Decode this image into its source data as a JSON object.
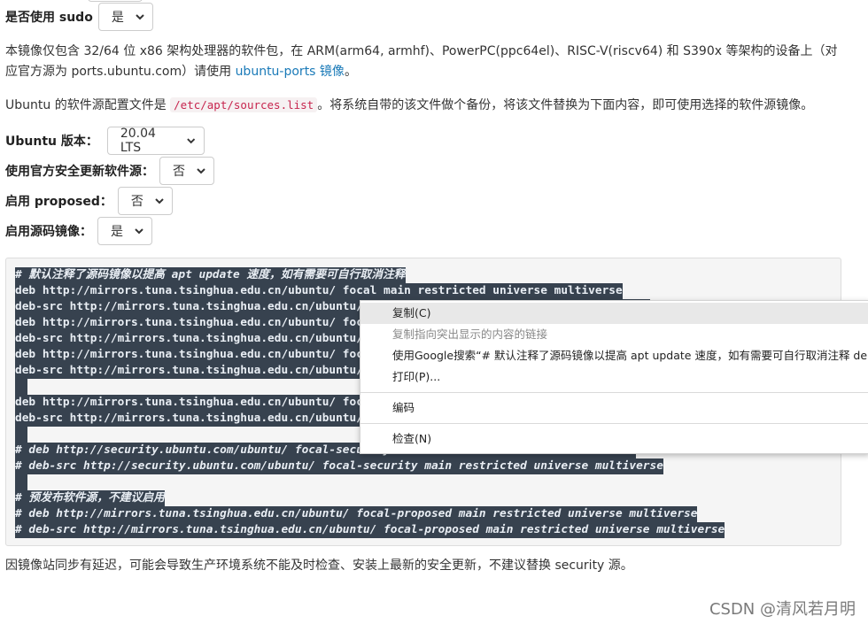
{
  "sudo": {
    "label": "是否使用 sudo",
    "value": "是"
  },
  "intro_paragraph": {
    "text": "本镜像仅包含 32/64 位 x86 架构处理器的软件包，在 ARM(arm64, armhf)、PowerPC(ppc64el)、RISC-V(riscv64) 和 S390x 等架构的设备上（对应官方源为 ports.ubuntu.com）请使用 ",
    "link": "ubuntu-ports 镜像",
    "suffix": "。"
  },
  "config_paragraph": {
    "prefix": "Ubuntu 的软件源配置文件是 ",
    "path": "/etc/apt/sources.list",
    "suffix": "。将系统自带的该文件做个备份，将该文件替换为下面内容，即可使用选择的软件源镜像。"
  },
  "options": {
    "version": {
      "label": "Ubuntu 版本：",
      "value": "20.04 LTS"
    },
    "security": {
      "label": "使用官方安全更新软件源：",
      "value": "否"
    },
    "proposed": {
      "label": "启用 proposed：",
      "value": "否"
    },
    "source": {
      "label": "启用源码镜像：",
      "value": "是"
    }
  },
  "code_lines": [
    "# 默认注释了源码镜像以提高 apt update 速度，如有需要可自行取消注释",
    "deb http://mirrors.tuna.tsinghua.edu.cn/ubuntu/ focal main restricted universe multiverse",
    "deb-src http://mirrors.tuna.tsinghua.edu.cn/ubuntu/ focal main restricted universe multiverse",
    "deb http://mirrors.tuna.tsinghua.edu.cn/ubuntu/ focal-updates main restricted universe multiverse",
    "deb-src http://mirrors.tuna.tsinghua.edu.cn/ubuntu/ focal-updates main restricted universe multiverse",
    "deb http://mirrors.tuna.tsinghua.edu.cn/ubuntu/ focal-backports main restricted universe multiverse",
    "deb-src http://mirrors.tuna.tsinghua.edu.cn/ubuntu/ focal-backports main restricted universe multiverse",
    "",
    "deb http://mirrors.tuna.tsinghua.edu.cn/ubuntu/ focal-security main restricted universe multiverse",
    "deb-src http://mirrors.tuna.tsinghua.edu.cn/ubuntu/ focal-security main restricted universe multiverse",
    "",
    "# deb http://security.ubuntu.com/ubuntu/ focal-security main restricted universe multiverse",
    "# deb-src http://security.ubuntu.com/ubuntu/ focal-security main restricted universe multiverse",
    "",
    "# 预发布软件源，不建议启用",
    "# deb http://mirrors.tuna.tsinghua.edu.cn/ubuntu/ focal-proposed main restricted universe multiverse",
    "# deb-src http://mirrors.tuna.tsinghua.edu.cn/ubuntu/ focal-proposed main restricted universe multiverse"
  ],
  "context_menu": {
    "copy": "复制(C)",
    "copy_link": "复制指向突出显示的内容的链接",
    "search": "使用Google搜索“# 默认注释了源码镜像以提高 apt update 速度，如有需要可自行取消注释 deb http://mirrors.tuna.tsinghua.edu.cn/ubuntu/ focal main”",
    "print": "打印(P)...",
    "encoding": "编码",
    "inspect": "检查(N)"
  },
  "footer_note": "因镜像站同步有延迟，可能会导致生产环境系统不能及时检查、安装上最新的安全更新，不建议替换 security 源。",
  "watermark": "CSDN @清风若月明"
}
